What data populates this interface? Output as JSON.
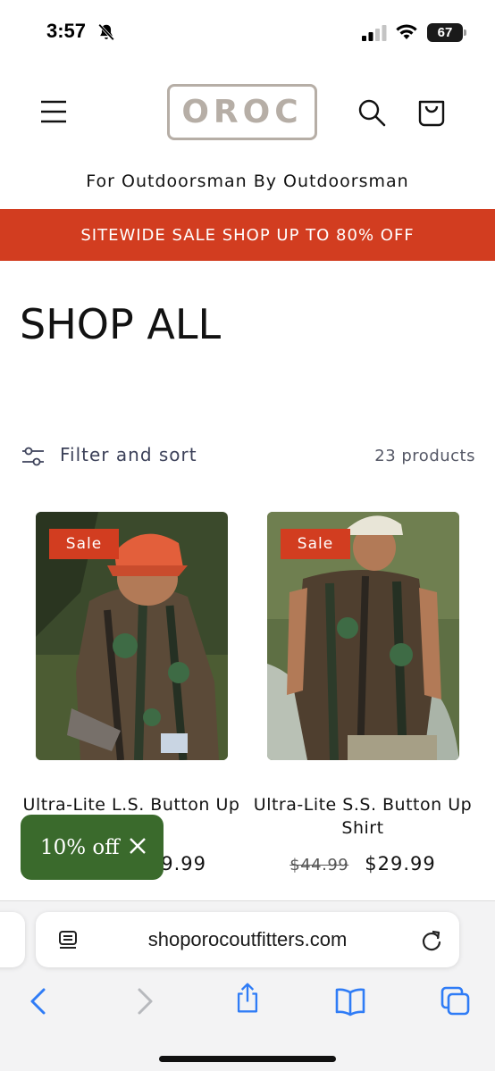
{
  "status_bar": {
    "time": "3:57",
    "battery": "67"
  },
  "header": {
    "logo": "OROC",
    "tagline": "For Outdoorsman By Outdoorsman",
    "sale_banner": "SITEWIDE SALE SHOP UP TO 80% OFF"
  },
  "collection": {
    "title": "SHOP ALL",
    "filter_label": "Filter and sort",
    "product_count": "23 products"
  },
  "products": [
    {
      "badge": "Sale",
      "title": "Ultra-Lite L.S. Button Up",
      "price": "$29.99",
      "price_visible": "9.99"
    },
    {
      "badge": "Sale",
      "title": "Ultra-Lite S.S. Button Up Shirt",
      "compare_price": "$44.99",
      "price": "$29.99"
    }
  ],
  "discount_popup": {
    "label": "10% off"
  },
  "browser": {
    "url": "shoporocoutfitters.com"
  },
  "colors": {
    "accent": "#d23d20",
    "popup": "#3a6a2c",
    "logo": "#b6aea6",
    "ios_blue": "#2f7cf6"
  },
  "icons": [
    "bell-off-icon",
    "cellular-signal-icon",
    "wifi-icon",
    "battery-icon",
    "hamburger-menu-icon",
    "search-icon",
    "cart-icon",
    "filter-sliders-icon",
    "close-icon",
    "reader-icon",
    "reload-icon",
    "back-icon",
    "forward-icon",
    "share-icon",
    "bookmarks-icon",
    "tabs-icon"
  ]
}
